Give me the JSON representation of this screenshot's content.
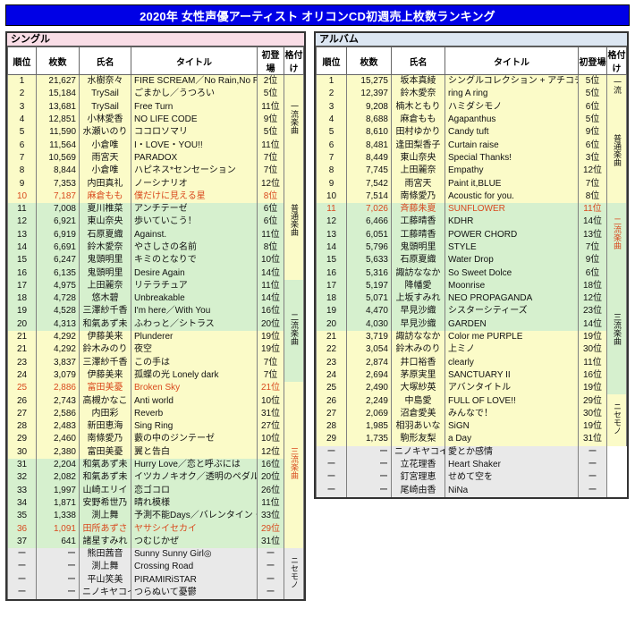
{
  "header": {
    "title": "2020年 女性声優アーティスト オリコンCD初週売上枚数ランキング",
    "title_bg": "#0000e6",
    "title_color": "#ffffff"
  },
  "columns": {
    "rank": "順位",
    "sales": "枚数",
    "name": "氏名",
    "title": "タイトル",
    "debut": "初登場",
    "grade": "格付け"
  },
  "grades": {
    "ichiryu": "一流楽曲",
    "ichiryu_album": "一流",
    "futsu": "普通楽曲",
    "niryu": "二流楽曲",
    "sanryu": "三流楽曲",
    "nisemono": "ニセモノ"
  },
  "singles": {
    "section_label": "シングル",
    "section_bg": "#f9dde6",
    "grade_groups": [
      {
        "label": "一流楽曲",
        "key": "ichiryu",
        "rows": 7,
        "color": "#ffff00"
      },
      {
        "label": "普通楽曲",
        "key": "futsu",
        "rows": 9,
        "color": "#d4d4d4"
      },
      {
        "label": "二流楽曲",
        "key": "niryu",
        "rows": 8,
        "color": "#0000e6"
      },
      {
        "label": "三流楽曲",
        "key": "sanryu",
        "rows": 13,
        "color": "#ffffff"
      },
      {
        "label": "ニセモノ",
        "key": "nisemono",
        "rows": 4,
        "color": "#f28c18"
      }
    ],
    "rows": [
      {
        "rank": "1",
        "sales": "21,627",
        "name": "水樹奈々",
        "title": "FIRE SCREAM／No Rain,No Rainbow",
        "debut": "2位",
        "tier": "gold",
        "hl": false
      },
      {
        "rank": "2",
        "sales": "15,184",
        "name": "TrySail",
        "title": "ごまかし／うつろい",
        "debut": "5位",
        "tier": "gold",
        "hl": false
      },
      {
        "rank": "3",
        "sales": "13,681",
        "name": "TrySail",
        "title": "Free Turn",
        "debut": "11位",
        "tier": "gold",
        "hl": false
      },
      {
        "rank": "4",
        "sales": "12,851",
        "name": "小林愛香",
        "title": "NO LIFE CODE",
        "debut": "9位",
        "tier": "gold",
        "hl": false
      },
      {
        "rank": "5",
        "sales": "11,590",
        "name": "水瀬いのり",
        "title": "ココロソマリ",
        "debut": "5位",
        "tier": "gold",
        "hl": false
      },
      {
        "rank": "6",
        "sales": "11,564",
        "name": "小倉唯",
        "title": "I・LOVE・YOU!!",
        "debut": "11位",
        "tier": "gold",
        "hl": false
      },
      {
        "rank": "7",
        "sales": "10,569",
        "name": "雨宮天",
        "title": "PARADOX",
        "debut": "7位",
        "tier": "gold",
        "hl": false
      },
      {
        "rank": "8",
        "sales": "8,844",
        "name": "小倉唯",
        "title": "ハピネス*センセーション",
        "debut": "7位",
        "tier": "gold",
        "hl": false
      },
      {
        "rank": "9",
        "sales": "7,353",
        "name": "内田真礼",
        "title": "ノーシナリオ",
        "debut": "12位",
        "tier": "gold",
        "hl": false
      },
      {
        "rank": "10",
        "sales": "7,187",
        "name": "麻倉もも",
        "title": "僕だけに見える星",
        "debut": "8位",
        "tier": "gold",
        "hl": true
      },
      {
        "rank": "11",
        "sales": "7,008",
        "name": "夏川椎菜",
        "title": "アンチテーゼ",
        "debut": "6位",
        "tier": "green",
        "hl": false
      },
      {
        "rank": "12",
        "sales": "6,921",
        "name": "東山奈央",
        "title": "歩いていこう！",
        "debut": "6位",
        "tier": "green",
        "hl": false
      },
      {
        "rank": "13",
        "sales": "6,919",
        "name": "石原夏織",
        "title": "Against.",
        "debut": "11位",
        "tier": "green",
        "hl": false
      },
      {
        "rank": "14",
        "sales": "6,691",
        "name": "鈴木愛奈",
        "title": "やさしさの名前",
        "debut": "8位",
        "tier": "green",
        "hl": false
      },
      {
        "rank": "15",
        "sales": "6,247",
        "name": "鬼頭明里",
        "title": "キミのとなりで",
        "debut": "10位",
        "tier": "green",
        "hl": false
      },
      {
        "rank": "16",
        "sales": "6,135",
        "name": "鬼頭明里",
        "title": "Desire Again",
        "debut": "14位",
        "tier": "green",
        "hl": false
      },
      {
        "rank": "17",
        "sales": "4,975",
        "name": "上田麗奈",
        "title": "リテラチュア",
        "debut": "11位",
        "tier": "green",
        "hl": false
      },
      {
        "rank": "18",
        "sales": "4,728",
        "name": "悠木碧",
        "title": "Unbreakable",
        "debut": "14位",
        "tier": "green",
        "hl": false
      },
      {
        "rank": "19",
        "sales": "4,528",
        "name": "三澤紗千香",
        "title": "I'm here／With You",
        "debut": "16位",
        "tier": "green",
        "hl": false
      },
      {
        "rank": "20",
        "sales": "4,313",
        "name": "和氣あず未",
        "title": "ふわっと／シトラス",
        "debut": "20位",
        "tier": "green",
        "hl": false
      },
      {
        "rank": "21",
        "sales": "4,292",
        "name": "伊藤美来",
        "title": "Plunderer",
        "debut": "19位",
        "tier": "gold",
        "hl": false
      },
      {
        "rank": "21",
        "sales": "4,292",
        "name": "鈴木みのり",
        "title": "夜空",
        "debut": "19位",
        "tier": "gold",
        "hl": false
      },
      {
        "rank": "23",
        "sales": "3,837",
        "name": "三澤紗千香",
        "title": "この手は",
        "debut": "7位",
        "tier": "gold",
        "hl": false
      },
      {
        "rank": "24",
        "sales": "3,079",
        "name": "伊藤美来",
        "title": "孤蝶の光 Lonely dark",
        "debut": "7位",
        "tier": "gold",
        "hl": false
      },
      {
        "rank": "25",
        "sales": "2,886",
        "name": "富田美憂",
        "title": "Broken Sky",
        "debut": "21位",
        "tier": "gold",
        "hl": true
      },
      {
        "rank": "26",
        "sales": "2,743",
        "name": "高槻かなこ",
        "title": "Anti world",
        "debut": "10位",
        "tier": "gold",
        "hl": false
      },
      {
        "rank": "27",
        "sales": "2,586",
        "name": "内田彩",
        "title": "Reverb",
        "debut": "31位",
        "tier": "gold",
        "hl": false
      },
      {
        "rank": "28",
        "sales": "2,483",
        "name": "新田恵海",
        "title": "Sing Ring",
        "debut": "27位",
        "tier": "gold",
        "hl": false
      },
      {
        "rank": "29",
        "sales": "2,460",
        "name": "南條愛乃",
        "title": "藪の中のジンテーゼ",
        "debut": "10位",
        "tier": "gold",
        "hl": false
      },
      {
        "rank": "30",
        "sales": "2,380",
        "name": "富田美憂",
        "title": "翼と告白",
        "debut": "12位",
        "tier": "gold",
        "hl": false
      },
      {
        "rank": "31",
        "sales": "2,204",
        "name": "和氣あず未",
        "title": "Hurry Love／恋と呼ぶには",
        "debut": "16位",
        "tier": "green",
        "hl": false
      },
      {
        "rank": "32",
        "sales": "2,082",
        "name": "和氣あず未",
        "title": "イツカノキオク／透明のペダル",
        "debut": "20位",
        "tier": "green",
        "hl": false
      },
      {
        "rank": "33",
        "sales": "1,997",
        "name": "山崎エリイ",
        "title": "恋ゴコロ",
        "debut": "26位",
        "tier": "green",
        "hl": false
      },
      {
        "rank": "34",
        "sales": "1,871",
        "name": "安野希世乃",
        "title": "晴れ模様",
        "debut": "11位",
        "tier": "green",
        "hl": false
      },
      {
        "rank": "35",
        "sales": "1,338",
        "name": "渕上舞",
        "title": "予測不能Days／バレンタイン・ハンター",
        "debut": "33位",
        "tier": "green",
        "hl": false
      },
      {
        "rank": "36",
        "sales": "1,091",
        "name": "田所あずさ",
        "title": "ヤサシイセカイ",
        "debut": "29位",
        "tier": "green",
        "hl": true
      },
      {
        "rank": "37",
        "sales": "641",
        "name": "諸星すみれ",
        "title": "つむじかぜ",
        "debut": "31位",
        "tier": "green",
        "hl": false
      },
      {
        "rank": "ー",
        "sales": "ー",
        "name": "熊田茜音",
        "title": "Sunny Sunny Girl◎",
        "debut": "ー",
        "tier": "gray",
        "hl": false
      },
      {
        "rank": "ー",
        "sales": "ー",
        "name": "渕上舞",
        "title": "Crossing Road",
        "debut": "ー",
        "tier": "gray",
        "hl": false
      },
      {
        "rank": "ー",
        "sales": "ー",
        "name": "平山笑美",
        "title": "PIRAMIRiSTAR",
        "debut": "ー",
        "tier": "gray",
        "hl": false
      },
      {
        "rank": "ー",
        "sales": "ー",
        "name": "ニノキヤコイ",
        "title": "つらぬいて憂鬱",
        "debut": "ー",
        "tier": "gray",
        "hl": false
      }
    ]
  },
  "albums": {
    "section_label": "アルバム",
    "section_bg": "#dce6f2",
    "grade_groups": [
      {
        "label": "一流",
        "key": "ichiryu",
        "rows": 2,
        "color": "#ffff00"
      },
      {
        "label": "普通楽曲",
        "key": "futsu",
        "rows": 8,
        "color": "#d4d4d4"
      },
      {
        "label": "二流楽曲",
        "key": "niryu",
        "rows": 5,
        "color": "#0000e6"
      },
      {
        "label": "三流楽曲",
        "key": "sanryu",
        "rows": 10,
        "color": "#ffffff"
      },
      {
        "label": "ニセモノ",
        "key": "nisemono",
        "rows": 4,
        "color": "#f28c18"
      }
    ],
    "rows": [
      {
        "rank": "1",
        "sales": "15,275",
        "name": "坂本真綾",
        "title": "シングルコレクション + アチコチ",
        "debut": "5位",
        "tier": "gold",
        "hl": false
      },
      {
        "rank": "2",
        "sales": "12,397",
        "name": "鈴木愛奈",
        "title": "ring A ring",
        "debut": "5位",
        "tier": "gold",
        "hl": false
      },
      {
        "rank": "3",
        "sales": "9,208",
        "name": "楠木ともり",
        "title": "ハミダシモノ",
        "debut": "6位",
        "tier": "gold",
        "hl": false
      },
      {
        "rank": "4",
        "sales": "8,688",
        "name": "麻倉もも",
        "title": "Agapanthus",
        "debut": "5位",
        "tier": "gold",
        "hl": false
      },
      {
        "rank": "5",
        "sales": "8,610",
        "name": "田村ゆかり",
        "title": "Candy tuft",
        "debut": "9位",
        "tier": "gold",
        "hl": false
      },
      {
        "rank": "6",
        "sales": "8,481",
        "name": "逢田梨香子",
        "title": "Curtain raise",
        "debut": "6位",
        "tier": "gold",
        "hl": false
      },
      {
        "rank": "7",
        "sales": "8,449",
        "name": "東山奈央",
        "title": "Special Thanks!",
        "debut": "3位",
        "tier": "gold",
        "hl": false
      },
      {
        "rank": "8",
        "sales": "7,745",
        "name": "上田麗奈",
        "title": "Empathy",
        "debut": "12位",
        "tier": "gold",
        "hl": false
      },
      {
        "rank": "9",
        "sales": "7,542",
        "name": "雨宮天",
        "title": "Paint it,BLUE",
        "debut": "7位",
        "tier": "gold",
        "hl": false
      },
      {
        "rank": "10",
        "sales": "7,514",
        "name": "南條愛乃",
        "title": "Acoustic for you.",
        "debut": "8位",
        "tier": "gold",
        "hl": false
      },
      {
        "rank": "11",
        "sales": "7,026",
        "name": "斉藤朱夏",
        "title": "SUNFLOWER",
        "debut": "11位",
        "tier": "green",
        "hl": true
      },
      {
        "rank": "12",
        "sales": "6,466",
        "name": "工藤晴香",
        "title": "KDHR",
        "debut": "14位",
        "tier": "green",
        "hl": false
      },
      {
        "rank": "13",
        "sales": "6,051",
        "name": "工藤晴香",
        "title": "POWER CHORD",
        "debut": "13位",
        "tier": "green",
        "hl": false
      },
      {
        "rank": "14",
        "sales": "5,796",
        "name": "鬼頭明里",
        "title": "STYLE",
        "debut": "7位",
        "tier": "green",
        "hl": false
      },
      {
        "rank": "15",
        "sales": "5,633",
        "name": "石原夏織",
        "title": "Water Drop",
        "debut": "9位",
        "tier": "green",
        "hl": false
      },
      {
        "rank": "16",
        "sales": "5,316",
        "name": "諏訪ななか",
        "title": "So Sweet Dolce",
        "debut": "6位",
        "tier": "green",
        "hl": false
      },
      {
        "rank": "17",
        "sales": "5,197",
        "name": "降幡愛",
        "title": "Moonrise",
        "debut": "18位",
        "tier": "green",
        "hl": false
      },
      {
        "rank": "18",
        "sales": "5,071",
        "name": "上坂すみれ",
        "title": "NEO PROPAGANDA",
        "debut": "12位",
        "tier": "green",
        "hl": false
      },
      {
        "rank": "19",
        "sales": "4,470",
        "name": "早見沙織",
        "title": "シスターシティーズ",
        "debut": "23位",
        "tier": "green",
        "hl": false
      },
      {
        "rank": "20",
        "sales": "4,030",
        "name": "早見沙織",
        "title": "GARDEN",
        "debut": "14位",
        "tier": "green",
        "hl": false
      },
      {
        "rank": "21",
        "sales": "3,719",
        "name": "諏訪ななか",
        "title": "Color me PURPLE",
        "debut": "19位",
        "tier": "gold",
        "hl": false
      },
      {
        "rank": "22",
        "sales": "3,054",
        "name": "鈴木みのり",
        "title": "上ミノ",
        "debut": "30位",
        "tier": "gold",
        "hl": false
      },
      {
        "rank": "23",
        "sales": "2,874",
        "name": "井口裕香",
        "title": "clearly",
        "debut": "11位",
        "tier": "gold",
        "hl": false
      },
      {
        "rank": "24",
        "sales": "2,694",
        "name": "茅原実里",
        "title": "SANCTUARY II",
        "debut": "16位",
        "tier": "gold",
        "hl": false
      },
      {
        "rank": "25",
        "sales": "2,490",
        "name": "大塚紗英",
        "title": "アバンタイトル",
        "debut": "19位",
        "tier": "gold",
        "hl": false
      },
      {
        "rank": "26",
        "sales": "2,249",
        "name": "中島愛",
        "title": "FULL OF LOVE!!",
        "debut": "29位",
        "tier": "gold",
        "hl": false
      },
      {
        "rank": "27",
        "sales": "2,069",
        "name": "沼倉愛美",
        "title": "みんなで！",
        "debut": "30位",
        "tier": "gold",
        "hl": false
      },
      {
        "rank": "28",
        "sales": "1,985",
        "name": "相羽あいな",
        "title": "SiGN",
        "debut": "19位",
        "tier": "gold",
        "hl": false
      },
      {
        "rank": "29",
        "sales": "1,735",
        "name": "駒形友梨",
        "title": "a Day",
        "debut": "31位",
        "tier": "gold",
        "hl": false
      },
      {
        "rank": "ー",
        "sales": "ー",
        "name": "ニノキヤコイ",
        "title": "愛とか感情",
        "debut": "ー",
        "tier": "gray",
        "hl": false
      },
      {
        "rank": "ー",
        "sales": "ー",
        "name": "立花理香",
        "title": "Heart Shaker",
        "debut": "ー",
        "tier": "gray",
        "hl": false
      },
      {
        "rank": "ー",
        "sales": "ー",
        "name": "釘宮理恵",
        "title": "せめて空を",
        "debut": "ー",
        "tier": "gray",
        "hl": false
      },
      {
        "rank": "ー",
        "sales": "ー",
        "name": "尾崎由香",
        "title": "NiNa",
        "debut": "ー",
        "tier": "gray",
        "hl": false
      }
    ]
  }
}
